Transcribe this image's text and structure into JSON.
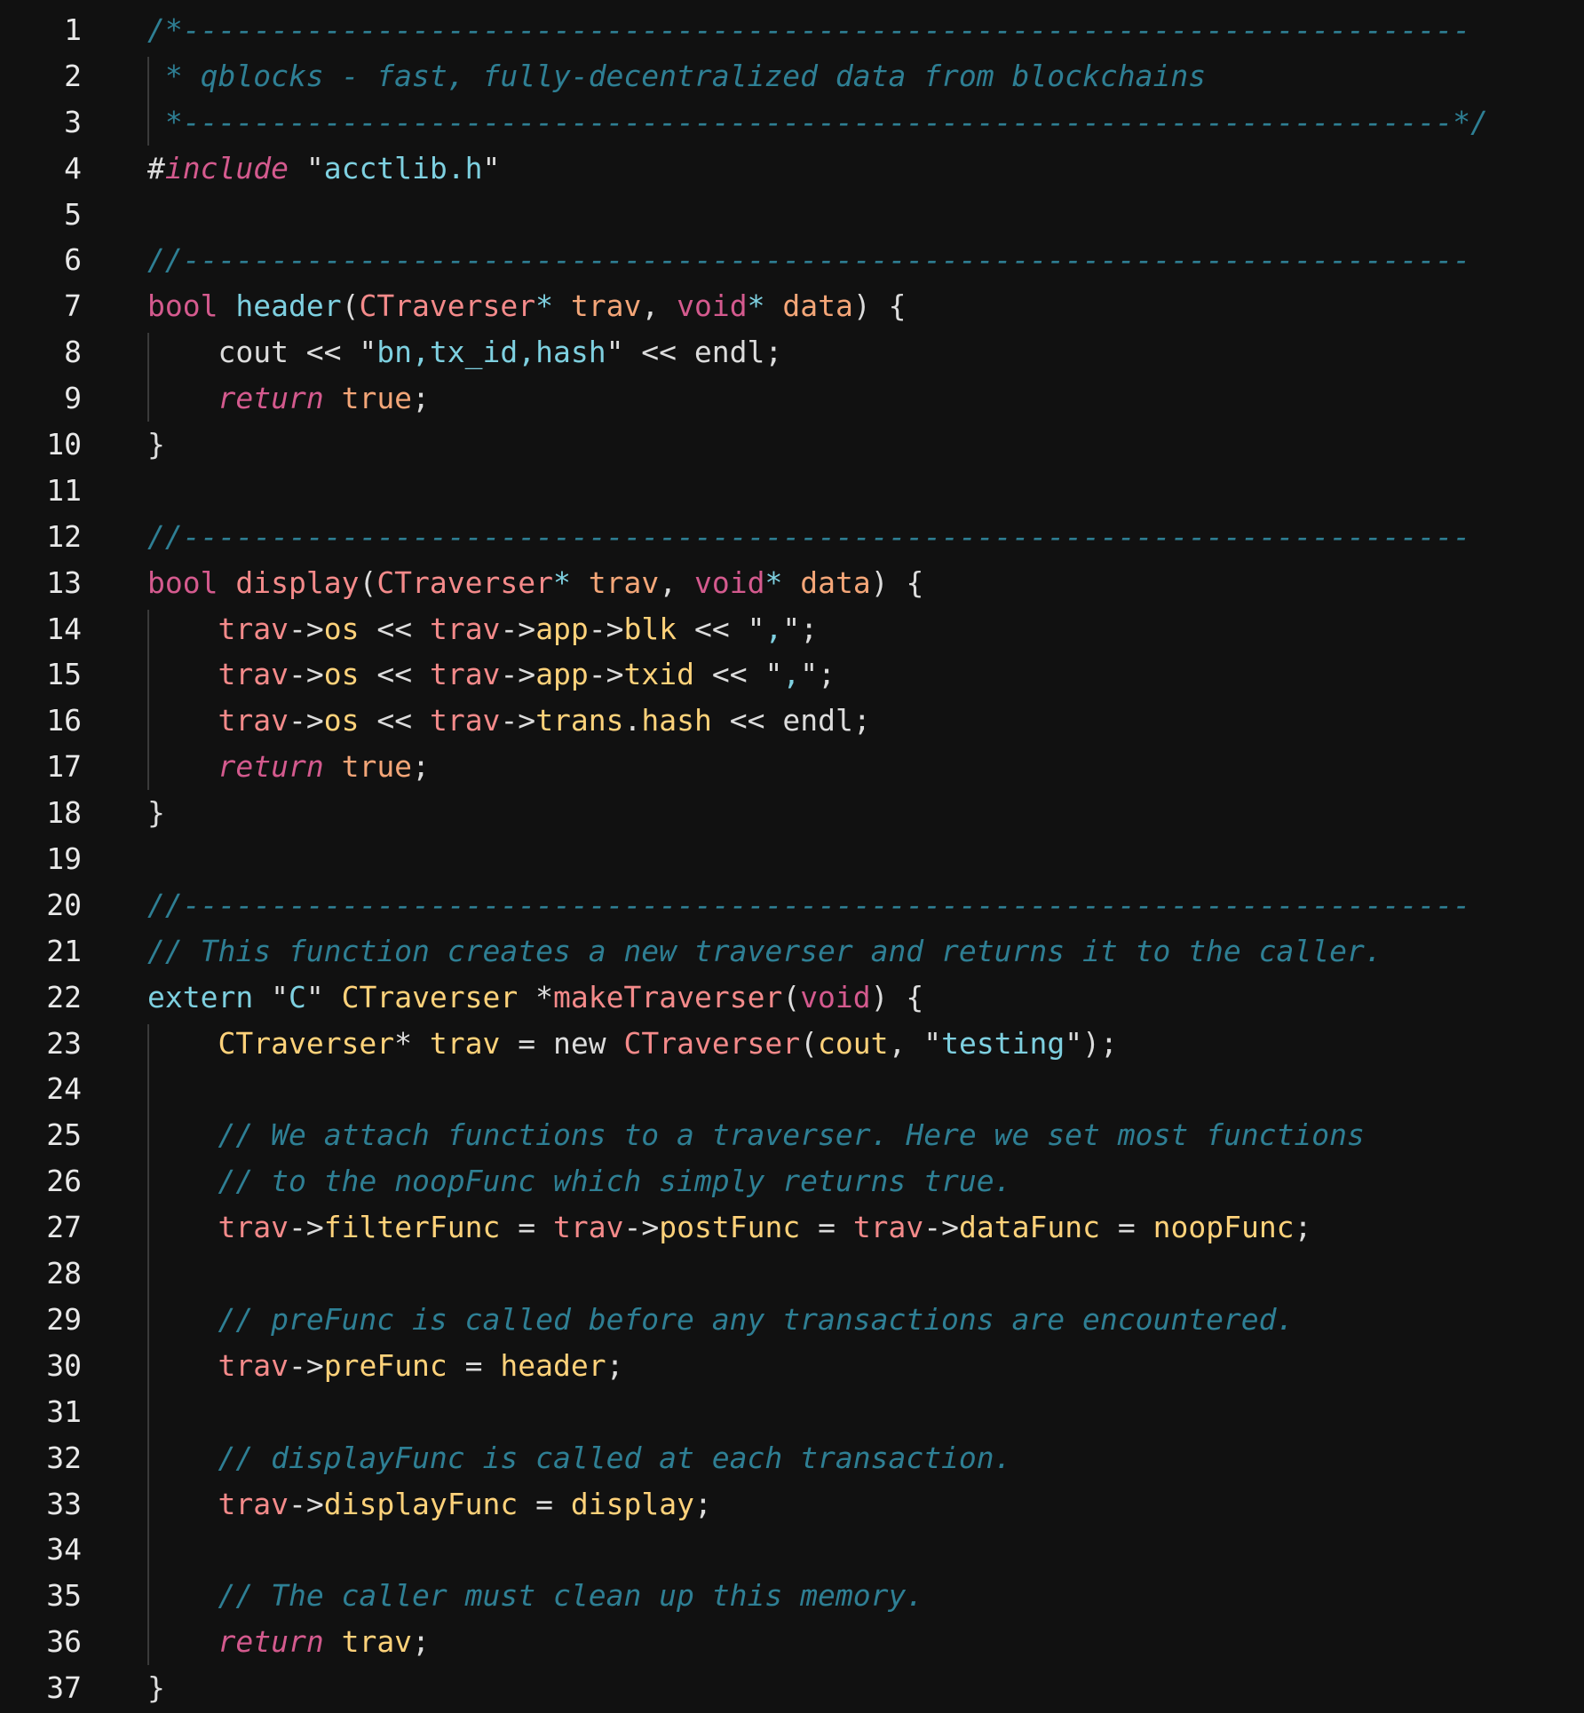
{
  "colors": {
    "background": "#111111",
    "line_number": "#e8e8e8",
    "comment": "#2e7f94",
    "keyword": "#d45a8e",
    "variable": "#f4a678",
    "function_name": "#7ed0e0",
    "type": "#f48a8a",
    "member": "#ffd27a",
    "string": "#7ed0e0",
    "plain": "#dcdcdc"
  },
  "lines": [
    {
      "n": "1",
      "tokens": [
        {
          "t": "c",
          "v": "/*-------------------------------------------------------------------------"
        }
      ]
    },
    {
      "n": "2",
      "tokens": [
        {
          "t": "c",
          "v": " * qblocks - fast, fully-decentralized data from blockchains"
        }
      ]
    },
    {
      "n": "3",
      "tokens": [
        {
          "t": "c",
          "v": " *------------------------------------------------------------------------*/"
        }
      ]
    },
    {
      "n": "4",
      "tokens": [
        {
          "t": "p",
          "v": "#"
        },
        {
          "t": "kwi",
          "v": "include"
        },
        {
          "t": "p",
          "v": " \""
        },
        {
          "t": "str",
          "v": "acctlib.h"
        },
        {
          "t": "p",
          "v": "\""
        }
      ]
    },
    {
      "n": "5",
      "tokens": []
    },
    {
      "n": "6",
      "tokens": [
        {
          "t": "c",
          "v": "//-------------------------------------------------------------------------"
        }
      ]
    },
    {
      "n": "7",
      "tokens": [
        {
          "t": "kw",
          "v": "bool"
        },
        {
          "t": "p",
          "v": " "
        },
        {
          "t": "fn",
          "v": "header"
        },
        {
          "t": "p",
          "v": "("
        },
        {
          "t": "type",
          "v": "CTraverser"
        },
        {
          "t": "op",
          "v": "*"
        },
        {
          "t": "p",
          "v": " "
        },
        {
          "t": "var",
          "v": "trav"
        },
        {
          "t": "p",
          "v": ", "
        },
        {
          "t": "kw",
          "v": "void"
        },
        {
          "t": "op",
          "v": "*"
        },
        {
          "t": "p",
          "v": " "
        },
        {
          "t": "var",
          "v": "data"
        },
        {
          "t": "p",
          "v": ") {"
        }
      ]
    },
    {
      "n": "8",
      "tokens": [
        {
          "t": "p",
          "v": "    cout << \""
        },
        {
          "t": "str",
          "v": "bn,tx_id,hash"
        },
        {
          "t": "p",
          "v": "\" << endl;"
        }
      ]
    },
    {
      "n": "9",
      "tokens": [
        {
          "t": "p",
          "v": "    "
        },
        {
          "t": "kwi",
          "v": "return"
        },
        {
          "t": "p",
          "v": " "
        },
        {
          "t": "var",
          "v": "true"
        },
        {
          "t": "p",
          "v": ";"
        }
      ]
    },
    {
      "n": "10",
      "tokens": [
        {
          "t": "p",
          "v": "}"
        }
      ]
    },
    {
      "n": "11",
      "tokens": []
    },
    {
      "n": "12",
      "tokens": [
        {
          "t": "c",
          "v": "//-------------------------------------------------------------------------"
        }
      ]
    },
    {
      "n": "13",
      "tokens": [
        {
          "t": "kw",
          "v": "bool"
        },
        {
          "t": "p",
          "v": " "
        },
        {
          "t": "type",
          "v": "display"
        },
        {
          "t": "p",
          "v": "("
        },
        {
          "t": "type",
          "v": "CTraverser"
        },
        {
          "t": "op",
          "v": "*"
        },
        {
          "t": "p",
          "v": " "
        },
        {
          "t": "var",
          "v": "trav"
        },
        {
          "t": "p",
          "v": ", "
        },
        {
          "t": "kw",
          "v": "void"
        },
        {
          "t": "op",
          "v": "*"
        },
        {
          "t": "p",
          "v": " "
        },
        {
          "t": "var",
          "v": "data"
        },
        {
          "t": "p",
          "v": ") {"
        }
      ]
    },
    {
      "n": "14",
      "tokens": [
        {
          "t": "p",
          "v": "    "
        },
        {
          "t": "type",
          "v": "trav"
        },
        {
          "t": "p",
          "v": "->"
        },
        {
          "t": "mb",
          "v": "os"
        },
        {
          "t": "p",
          "v": " << "
        },
        {
          "t": "type",
          "v": "trav"
        },
        {
          "t": "p",
          "v": "->"
        },
        {
          "t": "mb",
          "v": "app"
        },
        {
          "t": "p",
          "v": "->"
        },
        {
          "t": "mb",
          "v": "blk"
        },
        {
          "t": "p",
          "v": " << \""
        },
        {
          "t": "str",
          "v": ","
        },
        {
          "t": "p",
          "v": "\";"
        }
      ]
    },
    {
      "n": "15",
      "tokens": [
        {
          "t": "p",
          "v": "    "
        },
        {
          "t": "type",
          "v": "trav"
        },
        {
          "t": "p",
          "v": "->"
        },
        {
          "t": "mb",
          "v": "os"
        },
        {
          "t": "p",
          "v": " << "
        },
        {
          "t": "type",
          "v": "trav"
        },
        {
          "t": "p",
          "v": "->"
        },
        {
          "t": "mb",
          "v": "app"
        },
        {
          "t": "p",
          "v": "->"
        },
        {
          "t": "mb",
          "v": "txid"
        },
        {
          "t": "p",
          "v": " << \""
        },
        {
          "t": "str",
          "v": ","
        },
        {
          "t": "p",
          "v": "\";"
        }
      ]
    },
    {
      "n": "16",
      "tokens": [
        {
          "t": "p",
          "v": "    "
        },
        {
          "t": "type",
          "v": "trav"
        },
        {
          "t": "p",
          "v": "->"
        },
        {
          "t": "mb",
          "v": "os"
        },
        {
          "t": "p",
          "v": " << "
        },
        {
          "t": "type",
          "v": "trav"
        },
        {
          "t": "p",
          "v": "->"
        },
        {
          "t": "mb",
          "v": "trans"
        },
        {
          "t": "p",
          "v": "."
        },
        {
          "t": "mb",
          "v": "hash"
        },
        {
          "t": "p",
          "v": " << endl;"
        }
      ]
    },
    {
      "n": "17",
      "tokens": [
        {
          "t": "p",
          "v": "    "
        },
        {
          "t": "kwi",
          "v": "return"
        },
        {
          "t": "p",
          "v": " "
        },
        {
          "t": "var",
          "v": "true"
        },
        {
          "t": "p",
          "v": ";"
        }
      ]
    },
    {
      "n": "18",
      "tokens": [
        {
          "t": "p",
          "v": "}"
        }
      ]
    },
    {
      "n": "19",
      "tokens": []
    },
    {
      "n": "20",
      "tokens": [
        {
          "t": "c",
          "v": "//-------------------------------------------------------------------------"
        }
      ]
    },
    {
      "n": "21",
      "tokens": [
        {
          "t": "c",
          "v": "// This function creates a new traverser and returns it to the caller."
        }
      ]
    },
    {
      "n": "22",
      "tokens": [
        {
          "t": "ext",
          "v": "extern"
        },
        {
          "t": "p",
          "v": " \""
        },
        {
          "t": "str",
          "v": "C"
        },
        {
          "t": "p",
          "v": "\" "
        },
        {
          "t": "tl",
          "v": "CTraverser"
        },
        {
          "t": "p",
          "v": " *"
        },
        {
          "t": "type",
          "v": "makeTraverser"
        },
        {
          "t": "p",
          "v": "("
        },
        {
          "t": "kw",
          "v": "void"
        },
        {
          "t": "p",
          "v": ") {"
        }
      ]
    },
    {
      "n": "23",
      "tokens": [
        {
          "t": "p",
          "v": "    "
        },
        {
          "t": "tl",
          "v": "CTraverser"
        },
        {
          "t": "p",
          "v": "* "
        },
        {
          "t": "tl",
          "v": "trav"
        },
        {
          "t": "p",
          "v": " = new "
        },
        {
          "t": "type",
          "v": "CTraverser"
        },
        {
          "t": "p",
          "v": "("
        },
        {
          "t": "tl",
          "v": "cout"
        },
        {
          "t": "p",
          "v": ", \""
        },
        {
          "t": "str",
          "v": "testing"
        },
        {
          "t": "p",
          "v": "\");"
        }
      ]
    },
    {
      "n": "24",
      "tokens": []
    },
    {
      "n": "25",
      "tokens": [
        {
          "t": "p",
          "v": "    "
        },
        {
          "t": "c",
          "v": "// We attach functions to a traverser. Here we set most functions"
        }
      ]
    },
    {
      "n": "26",
      "tokens": [
        {
          "t": "p",
          "v": "    "
        },
        {
          "t": "c",
          "v": "// to the noopFunc which simply returns true."
        }
      ]
    },
    {
      "n": "27",
      "tokens": [
        {
          "t": "p",
          "v": "    "
        },
        {
          "t": "type",
          "v": "trav"
        },
        {
          "t": "p",
          "v": "->"
        },
        {
          "t": "mb",
          "v": "filterFunc"
        },
        {
          "t": "p",
          "v": " = "
        },
        {
          "t": "type",
          "v": "trav"
        },
        {
          "t": "p",
          "v": "->"
        },
        {
          "t": "mb",
          "v": "postFunc"
        },
        {
          "t": "p",
          "v": " = "
        },
        {
          "t": "type",
          "v": "trav"
        },
        {
          "t": "p",
          "v": "->"
        },
        {
          "t": "mb",
          "v": "dataFunc"
        },
        {
          "t": "p",
          "v": " = "
        },
        {
          "t": "mb",
          "v": "noopFunc"
        },
        {
          "t": "p",
          "v": ";"
        }
      ]
    },
    {
      "n": "28",
      "tokens": []
    },
    {
      "n": "29",
      "tokens": [
        {
          "t": "p",
          "v": "    "
        },
        {
          "t": "c",
          "v": "// preFunc is called before any transactions are encountered."
        }
      ]
    },
    {
      "n": "30",
      "tokens": [
        {
          "t": "p",
          "v": "    "
        },
        {
          "t": "type",
          "v": "trav"
        },
        {
          "t": "p",
          "v": "->"
        },
        {
          "t": "mb",
          "v": "preFunc"
        },
        {
          "t": "p",
          "v": " = "
        },
        {
          "t": "mb",
          "v": "header"
        },
        {
          "t": "p",
          "v": ";"
        }
      ]
    },
    {
      "n": "31",
      "tokens": []
    },
    {
      "n": "32",
      "tokens": [
        {
          "t": "p",
          "v": "    "
        },
        {
          "t": "c",
          "v": "// displayFunc is called at each transaction."
        }
      ]
    },
    {
      "n": "33",
      "tokens": [
        {
          "t": "p",
          "v": "    "
        },
        {
          "t": "type",
          "v": "trav"
        },
        {
          "t": "p",
          "v": "->"
        },
        {
          "t": "mb",
          "v": "displayFunc"
        },
        {
          "t": "p",
          "v": " = "
        },
        {
          "t": "mb",
          "v": "display"
        },
        {
          "t": "p",
          "v": ";"
        }
      ]
    },
    {
      "n": "34",
      "tokens": []
    },
    {
      "n": "35",
      "tokens": [
        {
          "t": "p",
          "v": "    "
        },
        {
          "t": "c",
          "v": "// The caller must clean up this memory."
        }
      ]
    },
    {
      "n": "36",
      "tokens": [
        {
          "t": "p",
          "v": "    "
        },
        {
          "t": "kwi",
          "v": "return"
        },
        {
          "t": "p",
          "v": " "
        },
        {
          "t": "tl",
          "v": "trav"
        },
        {
          "t": "p",
          "v": ";"
        }
      ]
    },
    {
      "n": "37",
      "tokens": [
        {
          "t": "p",
          "v": "}"
        }
      ]
    }
  ]
}
